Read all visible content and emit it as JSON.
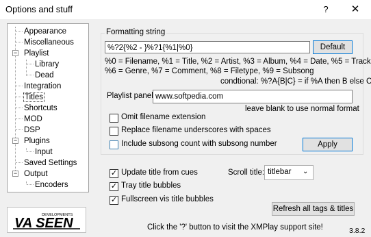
{
  "window": {
    "title": "Options and stuff",
    "help_label": "?",
    "close_label": "✕"
  },
  "tree": {
    "items": [
      {
        "label": "Appearance"
      },
      {
        "label": "Miscellaneous"
      },
      {
        "label": "Playlist"
      },
      {
        "label": "Library"
      },
      {
        "label": "Dead"
      },
      {
        "label": "Integration"
      },
      {
        "label": "Titles"
      },
      {
        "label": "Shortcuts"
      },
      {
        "label": "MOD"
      },
      {
        "label": "DSP"
      },
      {
        "label": "Plugins"
      },
      {
        "label": "Input"
      },
      {
        "label": "Saved Settings"
      },
      {
        "label": "Output"
      },
      {
        "label": "Encoders"
      }
    ],
    "expander_symbol": "−"
  },
  "logo": {
    "text": "VA SEEN",
    "subtext": "DEVELOPMENTS"
  },
  "formatting": {
    "group_label": "Formatting string",
    "value": "%?2{%2 - }%?1{%1|%0}",
    "default_button": "Default",
    "legend_line1": "%0 = Filename, %1 = Title, %2 = Artist, %3 = Album, %4 = Date, %5 = Track,",
    "legend_line2": "%6 = Genre, %7 = Comment, %8 = Filetype, %9 = Subsong",
    "legend_line3": "condtional:  %?A{B|C} = if %A then B else C",
    "playlist_panel_label": "Playlist panel:",
    "playlist_panel_value": "www.softpedia.com",
    "playlist_panel_hint": "leave blank to use normal format",
    "omit_ext_label": "Omit filename extension",
    "replace_underscores_label": "Replace filename underscores with spaces",
    "include_subsong_label": "Include subsong count with subsong number",
    "apply_button": "Apply"
  },
  "options": {
    "update_title_label": "Update title from cues",
    "tray_bubbles_label": "Tray title bubbles",
    "fullscreen_bubbles_label": "Fullscreen vis title bubbles",
    "scroll_title_label": "Scroll title:",
    "scroll_title_value": "titlebar",
    "refresh_button": "Refresh all tags & titles",
    "check_mark": "✓"
  },
  "footer": {
    "support_text": "Click the '?' button to visit the XMPlay support site!",
    "version": "3.8.2"
  }
}
